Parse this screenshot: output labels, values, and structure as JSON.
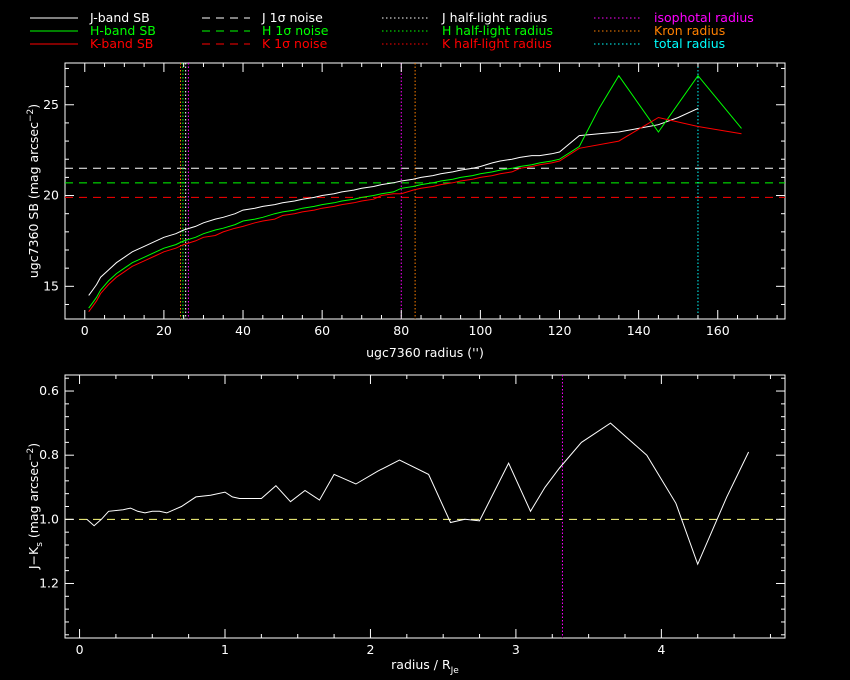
{
  "legend": {
    "items": [
      {
        "label": "J-band SB",
        "color": "#ffffff",
        "dash": "solid",
        "col": 0,
        "row": 0
      },
      {
        "label": "H-band SB",
        "color": "#00ff00",
        "dash": "solid",
        "col": 0,
        "row": 1
      },
      {
        "label": "K-band SB",
        "color": "#ff0000",
        "dash": "solid",
        "col": 0,
        "row": 2
      },
      {
        "label": "J 1σ noise",
        "color": "#ffffff",
        "dash": "dashed",
        "col": 1,
        "row": 0
      },
      {
        "label": "H 1σ noise",
        "color": "#00ff00",
        "dash": "dashed",
        "col": 1,
        "row": 1
      },
      {
        "label": "K 1σ noise",
        "color": "#ff0000",
        "dash": "dashed",
        "col": 1,
        "row": 2
      },
      {
        "label": "J half-light radius",
        "color": "#ffffff",
        "dash": "dotted",
        "col": 2,
        "row": 0
      },
      {
        "label": "H half-light radius",
        "color": "#00ff00",
        "dash": "dotted",
        "col": 2,
        "row": 1
      },
      {
        "label": "K half-light radius",
        "color": "#ff0000",
        "dash": "dotted",
        "col": 2,
        "row": 2
      },
      {
        "label": "isophotal radius",
        "color": "#ff00ff",
        "dash": "dotted",
        "col": 3,
        "row": 0
      },
      {
        "label": "Kron radius",
        "color": "#ff8000",
        "dash": "dotted",
        "col": 3,
        "row": 1
      },
      {
        "label": "total radius",
        "color": "#00ffff",
        "dash": "dotted",
        "col": 3,
        "row": 2
      }
    ]
  },
  "chart_data": [
    {
      "type": "line",
      "xlabel": "ugc7360 radius ('')",
      "ylabel": "ugc7360 SB (mag arcsec",
      "ylabel_sup": "−2",
      "ylabel_end": ")",
      "xlim": [
        -5,
        177
      ],
      "ylim": [
        27.3,
        13.2
      ],
      "xticks": [
        0,
        20,
        40,
        60,
        80,
        100,
        120,
        140,
        160
      ],
      "yticks": [
        15,
        20,
        25
      ],
      "series": [
        {
          "name": "J-band SB",
          "color": "#ffffff",
          "x": [
            1,
            2,
            3,
            4,
            6,
            8,
            10,
            12,
            15,
            18,
            20,
            23,
            25,
            28,
            30,
            33,
            35,
            38,
            40,
            43,
            45,
            48,
            50,
            53,
            55,
            58,
            60,
            63,
            65,
            68,
            70,
            73,
            75,
            78,
            80,
            83,
            85,
            88,
            90,
            93,
            95,
            98,
            100,
            103,
            105,
            108,
            110,
            113,
            115,
            118,
            120,
            125,
            130,
            135,
            140,
            145,
            150,
            155
          ],
          "y": [
            14.5,
            14.8,
            15.1,
            15.5,
            15.9,
            16.3,
            16.6,
            16.9,
            17.2,
            17.5,
            17.7,
            17.9,
            18.1,
            18.3,
            18.5,
            18.7,
            18.8,
            19.0,
            19.2,
            19.3,
            19.4,
            19.5,
            19.6,
            19.7,
            19.8,
            19.9,
            20.0,
            20.1,
            20.2,
            20.3,
            20.4,
            20.5,
            20.6,
            20.7,
            20.8,
            20.9,
            21.0,
            21.1,
            21.2,
            21.3,
            21.4,
            21.5,
            21.6,
            21.8,
            21.9,
            22.0,
            22.1,
            22.2,
            22.2,
            22.3,
            22.4,
            23.3,
            23.4,
            23.5,
            23.7,
            23.9,
            24.3,
            24.8
          ]
        },
        {
          "name": "H-band SB",
          "color": "#00ff00",
          "x": [
            1,
            2,
            3,
            4,
            6,
            8,
            10,
            12,
            15,
            18,
            20,
            23,
            25,
            28,
            30,
            33,
            35,
            38,
            40,
            43,
            45,
            48,
            50,
            53,
            55,
            58,
            60,
            63,
            65,
            68,
            70,
            73,
            75,
            78,
            80,
            83,
            85,
            88,
            90,
            93,
            95,
            98,
            100,
            103,
            105,
            108,
            110,
            113,
            115,
            118,
            120,
            125,
            130,
            135,
            145,
            155,
            166
          ],
          "y": [
            13.8,
            14.1,
            14.4,
            14.8,
            15.3,
            15.7,
            16.0,
            16.3,
            16.6,
            16.9,
            17.1,
            17.3,
            17.5,
            17.7,
            17.9,
            18.1,
            18.2,
            18.4,
            18.6,
            18.7,
            18.8,
            19.0,
            19.1,
            19.2,
            19.3,
            19.4,
            19.5,
            19.6,
            19.7,
            19.8,
            19.9,
            20.0,
            20.1,
            20.2,
            20.4,
            20.5,
            20.6,
            20.7,
            20.8,
            20.9,
            21.0,
            21.1,
            21.2,
            21.3,
            21.4,
            21.5,
            21.6,
            21.7,
            21.8,
            21.9,
            22.0,
            22.7,
            24.8,
            26.6,
            23.5,
            26.6,
            23.7
          ]
        },
        {
          "name": "K-band SB",
          "color": "#ff0000",
          "x": [
            1,
            2,
            3,
            4,
            6,
            8,
            10,
            12,
            15,
            18,
            20,
            23,
            25,
            28,
            30,
            33,
            35,
            38,
            40,
            43,
            45,
            48,
            50,
            53,
            55,
            58,
            60,
            63,
            65,
            68,
            70,
            73,
            75,
            78,
            80,
            83,
            85,
            88,
            90,
            93,
            95,
            98,
            100,
            103,
            105,
            108,
            110,
            113,
            115,
            118,
            120,
            125,
            135,
            145,
            155,
            166
          ],
          "y": [
            13.6,
            13.9,
            14.2,
            14.6,
            15.1,
            15.5,
            15.8,
            16.1,
            16.4,
            16.7,
            16.9,
            17.1,
            17.3,
            17.5,
            17.7,
            17.8,
            18.0,
            18.2,
            18.3,
            18.5,
            18.6,
            18.7,
            18.9,
            19.0,
            19.1,
            19.2,
            19.3,
            19.4,
            19.5,
            19.6,
            19.7,
            19.8,
            20.0,
            20.1,
            20.1,
            20.3,
            20.4,
            20.5,
            20.6,
            20.7,
            20.8,
            20.9,
            21.0,
            21.1,
            21.2,
            21.3,
            21.5,
            21.6,
            21.7,
            21.8,
            21.9,
            22.6,
            23.0,
            24.3,
            23.8,
            23.4
          ]
        }
      ],
      "hlines": [
        {
          "name": "J 1σ noise",
          "y": 21.5,
          "color": "#ffffff"
        },
        {
          "name": "H 1σ noise",
          "y": 20.7,
          "color": "#00ff00"
        },
        {
          "name": "K 1σ noise",
          "y": 19.9,
          "color": "#ff0000"
        }
      ],
      "vlines": [
        {
          "name": "Kron radius",
          "x": 24.2,
          "color": "#ff8000"
        },
        {
          "name": "H half-light radius",
          "x": 24.8,
          "color": "#00ff00"
        },
        {
          "name": "J half-light radius",
          "x": 25.5,
          "color": "#ffffff"
        },
        {
          "name": "K half-light radius",
          "x": 26.2,
          "color": "#ff00ff"
        },
        {
          "name": "isophotal radius",
          "x": 80.0,
          "color": "#ff00ff"
        },
        {
          "name": "Kron radius",
          "x": 83.5,
          "color": "#ff8000"
        },
        {
          "name": "total radius",
          "x": 155.0,
          "color": "#00ffff"
        }
      ]
    },
    {
      "type": "line",
      "xlabel": "radius / R",
      "xlabel_sub": "Je",
      "ylabel": "J−K",
      "ylabel_sub": "s",
      "ylabel_mid": " (mag arcsec",
      "ylabel_sup": "−2",
      "ylabel_end": ")",
      "xlim": [
        -0.1,
        4.85
      ],
      "ylim": [
        0.55,
        1.37
      ],
      "xticks": [
        0,
        1,
        2,
        3,
        4
      ],
      "yticks": [
        0.6,
        0.8,
        1.0,
        1.2
      ],
      "series": [
        {
          "name": "J−Ks",
          "color": "#ffffff",
          "x": [
            0.05,
            0.1,
            0.15,
            0.2,
            0.3,
            0.35,
            0.4,
            0.45,
            0.5,
            0.55,
            0.6,
            0.7,
            0.8,
            0.9,
            1.0,
            1.05,
            1.1,
            1.2,
            1.25,
            1.35,
            1.45,
            1.55,
            1.65,
            1.75,
            1.8,
            1.9,
            2.05,
            2.2,
            2.4,
            2.55,
            2.65,
            2.75,
            2.95,
            3.1,
            3.2,
            3.3,
            3.45,
            3.65,
            3.9,
            4.1,
            4.25,
            4.45,
            4.6
          ],
          "y": [
            1.0,
            1.02,
            1.0,
            0.975,
            0.97,
            0.965,
            0.975,
            0.98,
            0.975,
            0.975,
            0.98,
            0.96,
            0.93,
            0.925,
            0.915,
            0.93,
            0.935,
            0.935,
            0.935,
            0.895,
            0.945,
            0.91,
            0.94,
            0.86,
            0.87,
            0.89,
            0.85,
            0.815,
            0.86,
            1.01,
            1.0,
            1.005,
            0.825,
            0.975,
            0.9,
            0.84,
            0.76,
            0.7,
            0.8,
            0.95,
            1.14,
            0.93,
            0.79
          ]
        }
      ],
      "hlines": [
        {
          "name": "",
          "y": 1.0,
          "color": "#ffff80"
        }
      ],
      "vlines": [
        {
          "name": "isophotal radius",
          "x": 3.32,
          "color": "#ff00ff"
        }
      ]
    }
  ]
}
